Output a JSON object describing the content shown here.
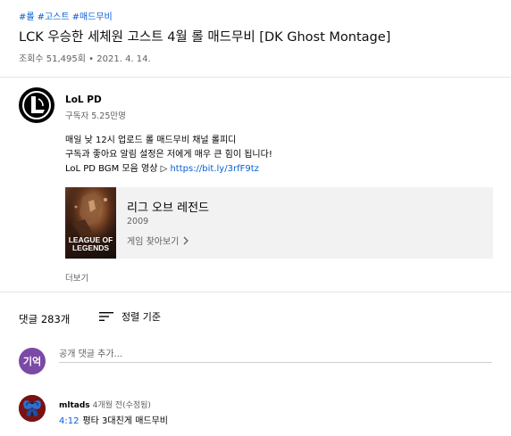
{
  "video": {
    "hashtags": [
      "#롤",
      "#고스트",
      "#매드무비"
    ],
    "title": "LCK 우승한 세체원 고스트 4월 롤 매드무비 [DK Ghost Montage]",
    "views": "조회수 51,495회",
    "dot": "•",
    "date": "2021. 4. 14."
  },
  "channel": {
    "name": "LoL PD",
    "subscribers": "구독자 5.25만명"
  },
  "description": {
    "line1": "매일 낮 12시 업로드 롤 매드무비 채널 롤피디",
    "line2": "구독과 좋아요 알림 설정은 저에게 매우 큰 힘이 됩니다!",
    "line3_text": "LoL PD BGM 모음 영상 ▷ ",
    "line3_link": "https://bit.ly/3rfF9tz"
  },
  "game_card": {
    "title": "리그 오브 레전드",
    "year": "2009",
    "browse_label": "게임 찾아보기",
    "logo_line1": "LEAGUE OF",
    "logo_line2": "LEGENDS"
  },
  "more_label": "더보기",
  "comments": {
    "count_label": "댓글 283개",
    "sort_label": "정렬 기준",
    "my_avatar_text": "기억",
    "add_placeholder": "공개 댓글 추가...",
    "items": [
      {
        "author": "mltads",
        "time": "4개월 전(수정됨)",
        "timestamp_link": "4:12",
        "text": "평타 3대친게 매드무비"
      }
    ]
  },
  "colors": {
    "link": "#065fd4",
    "secondary_text": "#606060",
    "card_bg": "#f2f2f2",
    "my_avatar_bg": "#7b49a6"
  }
}
